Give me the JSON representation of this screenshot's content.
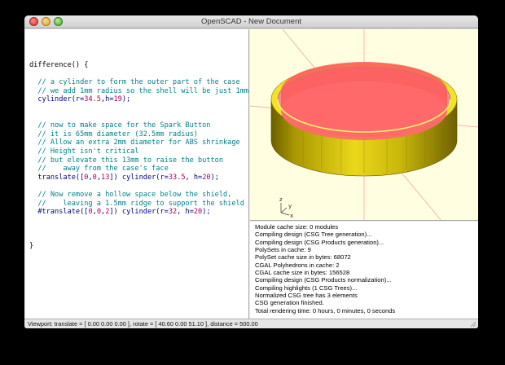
{
  "window": {
    "title": "OpenSCAD - New Document"
  },
  "editor": {
    "lines": [
      {
        "t": "key",
        "text": "difference() {"
      },
      {
        "t": "blank",
        "text": ""
      },
      {
        "t": "comment",
        "text": "  // a cylinder to form the outer part of the case"
      },
      {
        "t": "comment",
        "text": "  // we add 1mm radius so the shell will be just 1mm"
      },
      {
        "t": "code",
        "text": "  cylinder(r=34.5,h=19);"
      },
      {
        "t": "blank",
        "text": ""
      },
      {
        "t": "blank",
        "text": ""
      },
      {
        "t": "comment",
        "text": "  // now to make space for the Spark Button"
      },
      {
        "t": "comment",
        "text": "  // it is 65mm diameter (32.5mm radius)"
      },
      {
        "t": "comment",
        "text": "  // Allow an extra 2mm diameter for ABS shrinkage"
      },
      {
        "t": "comment",
        "text": "  // Height isn't critical"
      },
      {
        "t": "comment",
        "text": "  // but elevate this 13mm to raise the button"
      },
      {
        "t": "comment",
        "text": "  //    away from the case's face"
      },
      {
        "t": "code",
        "text": "  translate([0,0,13]) cylinder(r=33.5, h=20);"
      },
      {
        "t": "blank",
        "text": ""
      },
      {
        "t": "comment",
        "text": "  // Now remove a hollow space below the shield,"
      },
      {
        "t": "comment",
        "text": "  //    leaving a 1.5mm ridge to support the shield"
      },
      {
        "t": "code",
        "text": "  #translate([0,0,2]) cylinder(r=32, h=20);"
      },
      {
        "t": "blank",
        "text": ""
      },
      {
        "t": "blank",
        "text": ""
      },
      {
        "t": "blank",
        "text": ""
      },
      {
        "t": "key",
        "text": "}"
      }
    ]
  },
  "axes": {
    "x": "x",
    "y": "y",
    "z": "z"
  },
  "console": {
    "lines": [
      "Module cache size: 0 modules",
      "Compiling design (CSG Tree generation)...",
      "Compiling design (CSG Products generation)...",
      "PolySets in cache: 9",
      "PolySet cache size in bytes: 68072",
      "CGAL Polyhedrons in cache: 2",
      "CGAL cache size in bytes: 156528",
      "Compiling design (CSG Products normalization)...",
      "Compiling highlights (1 CSG Trees)...",
      "Normalized CSG tree has 3 elements",
      "CSG generation finished.",
      "Total rendering time: 0 hours, 0 minutes, 0 seconds"
    ]
  },
  "statusbar": {
    "text": "Viewport: translate = [ 0.00 0.00 0.00 ], rotate = [ 40.60 0.00 51.10 ], distance = 500.00"
  },
  "colors": {
    "viewport_bg": "#fffee0",
    "shell": "#e0cc10",
    "highlight": "#ff6666",
    "comment": "#00808a",
    "number": "#a00060"
  }
}
